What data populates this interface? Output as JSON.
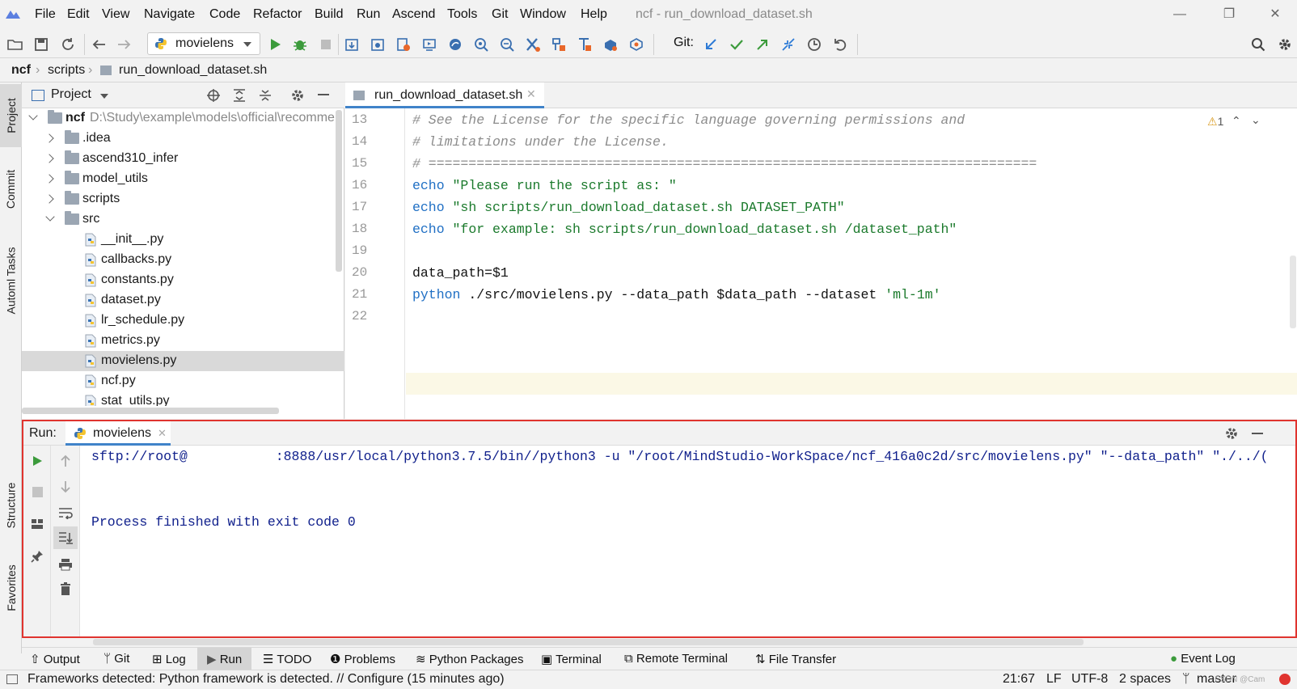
{
  "app": {
    "window_title": "ncf - run_download_dataset.sh"
  },
  "menu": [
    "File",
    "Edit",
    "View",
    "Navigate",
    "Code",
    "Refactor",
    "Build",
    "Run",
    "Ascend",
    "Tools",
    "Git",
    "Window",
    "Help"
  ],
  "toolbar": {
    "run_config": "movielens",
    "git_label": "Git:"
  },
  "breadcrumb": [
    "ncf",
    "scripts",
    "run_download_dataset.sh"
  ],
  "left_tabs": [
    "Project",
    "Commit",
    "Automl Tasks",
    "Structure",
    "Favorites"
  ],
  "project": {
    "title": "Project",
    "root": {
      "name": "ncf",
      "path": "D:\\Study\\example\\models\\official\\recomme"
    },
    "items": [
      {
        "name": ".idea",
        "type": "folder"
      },
      {
        "name": "ascend310_infer",
        "type": "folder"
      },
      {
        "name": "model_utils",
        "type": "folder"
      },
      {
        "name": "scripts",
        "type": "folder"
      },
      {
        "name": "src",
        "type": "folder-open"
      },
      {
        "name": "__init__.py",
        "type": "py"
      },
      {
        "name": "callbacks.py",
        "type": "py"
      },
      {
        "name": "constants.py",
        "type": "py"
      },
      {
        "name": "dataset.py",
        "type": "py"
      },
      {
        "name": "lr_schedule.py",
        "type": "py"
      },
      {
        "name": "metrics.py",
        "type": "py"
      },
      {
        "name": "movielens.py",
        "type": "py"
      },
      {
        "name": "ncf.py",
        "type": "py"
      },
      {
        "name": "stat_utils.py",
        "type": "py"
      }
    ]
  },
  "editor": {
    "tab": "run_download_dataset.sh",
    "warning_count": "1",
    "line_numbers": [
      "13",
      "14",
      "15",
      "16",
      "17",
      "18",
      "19",
      "20",
      "21",
      "22"
    ],
    "lines": {
      "l13": "# See the License for the specific language governing permissions and",
      "l14": "# limitations under the License.",
      "l15": "# ============================================================================",
      "l16_kw": "echo",
      "l16_str": " \"Please run the script as: \"",
      "l17_kw": "echo",
      "l17_str": " \"sh scripts/run_download_dataset.sh DATASET_PATH\"",
      "l18_kw": "echo",
      "l18_str": " \"for example: sh scripts/run_download_dataset.sh /dataset_path\"",
      "l20": "data_path=$1",
      "l21_kw": "python",
      "l21_mid": " ./src/movielens.py --data_path $data_path --dataset ",
      "l21_str": "'ml-1m'"
    }
  },
  "run": {
    "label": "Run:",
    "tab": "movielens",
    "output_cmd": "sftp://root@           :8888/usr/local/python3.7.5/bin//python3 -u \"/root/MindStudio-WorkSpace/ncf_416a0c2d/src/movielens.py\" \"--data_path\" \"./../(",
    "output_exit": "Process finished with exit code 0"
  },
  "bottom_tools": [
    "Output",
    "Git",
    "Log",
    "Run",
    "TODO",
    "Problems",
    "Python Packages",
    "Terminal",
    "Remote Terminal",
    "File Transfer",
    "Event Log"
  ],
  "status": {
    "message": "Frameworks detected: Python framework is detected. // Configure (15 minutes ago)",
    "position": "21:67",
    "line_sep": "LF",
    "encoding": "UTF-8",
    "indent": "2 spaces",
    "branch": "master",
    "watermark": "CSDN @Cam"
  },
  "colors": {
    "accent": "#4083c9",
    "run_green": "#3c9b3c",
    "highlight_border": "#e0342f",
    "keyword": "#1f6fc4",
    "string": "#1b7a2c"
  }
}
